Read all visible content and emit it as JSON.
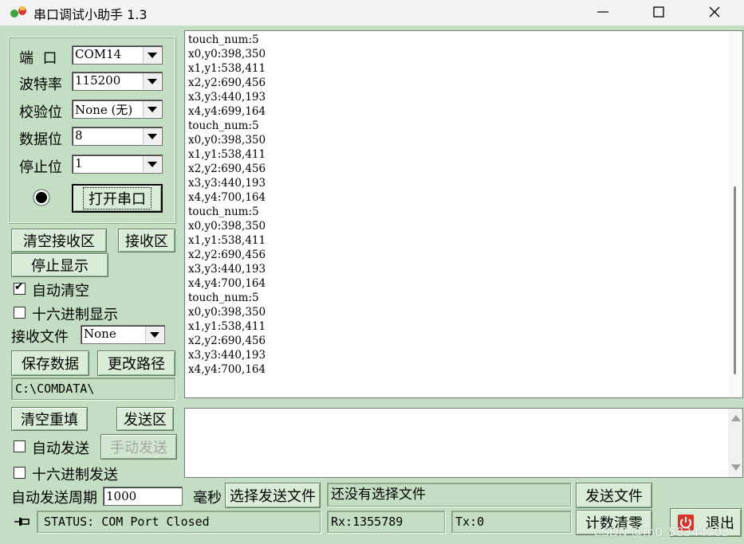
{
  "window": {
    "title": "串口调试小助手 1.3"
  },
  "colors": {
    "panel_bg": "#c3dec3",
    "titlebar_bg": "#f3f3f3",
    "exit_icon_red": "#d9362b"
  },
  "port_settings": {
    "port_label": "端  口",
    "port_value": "COM14",
    "baud_label": "波特率",
    "baud_value": "115200",
    "parity_label": "校验位",
    "parity_value": "None (无)",
    "databits_label": "数据位",
    "databits_value": "8",
    "stopbits_label": "停止位",
    "stopbits_value": "1",
    "open_port_label": "打开串口"
  },
  "receive_controls": {
    "clear_label": "清空接收区",
    "area_label": "接收区",
    "stop_display_label": "停止显示",
    "auto_clear_label": "自动清空",
    "auto_clear_checked": true,
    "hex_display_label": "十六进制显示",
    "hex_display_checked": false,
    "recv_file_label": "接收文件",
    "recv_file_value": "None",
    "save_data_label": "保存数据",
    "change_path_label": "更改路径",
    "path_value": "C:\\COMDATA\\"
  },
  "receive_area": {
    "lines": [
      "touch_num:5",
      "x0,y0:398,350",
      "x1,y1:538,411",
      "x2,y2:690,456",
      "x3,y3:440,193",
      "x4,y4:699,164",
      "touch_num:5",
      "x0,y0:398,350",
      "x1,y1:538,411",
      "x2,y2:690,456",
      "x3,y3:440,193",
      "x4,y4:700,164",
      "touch_num:5",
      "x0,y0:398,350",
      "x1,y1:538,411",
      "x2,y2:690,456",
      "x3,y3:440,193",
      "x4,y4:700,164",
      "touch_num:5",
      "x0,y0:398,350",
      "x1,y1:538,411",
      "x2,y2:690,456",
      "x3,y3:440,193",
      "x4,y4:700,164"
    ]
  },
  "send_controls": {
    "clear_refill_label": "清空重填",
    "send_area_label": "发送区",
    "auto_send_label": "自动发送",
    "auto_send_checked": false,
    "manual_send_label": "手动发送",
    "hex_send_label": "十六进制发送",
    "hex_send_checked": false,
    "period_label": "自动发送周期",
    "period_value": "1000",
    "ms_label": "毫秒",
    "choose_file_label": "选择发送文件",
    "file_status": "还没有选择文件",
    "send_file_label": "发送文件",
    "reset_count_label": "计数清零",
    "exit_label": "退出"
  },
  "status_bar": {
    "status_text": "STATUS: COM Port Closed",
    "rx_text": "Rx:1355789",
    "tx_text": "Tx:0"
  },
  "watermark": "CSDN @m0_58344703"
}
